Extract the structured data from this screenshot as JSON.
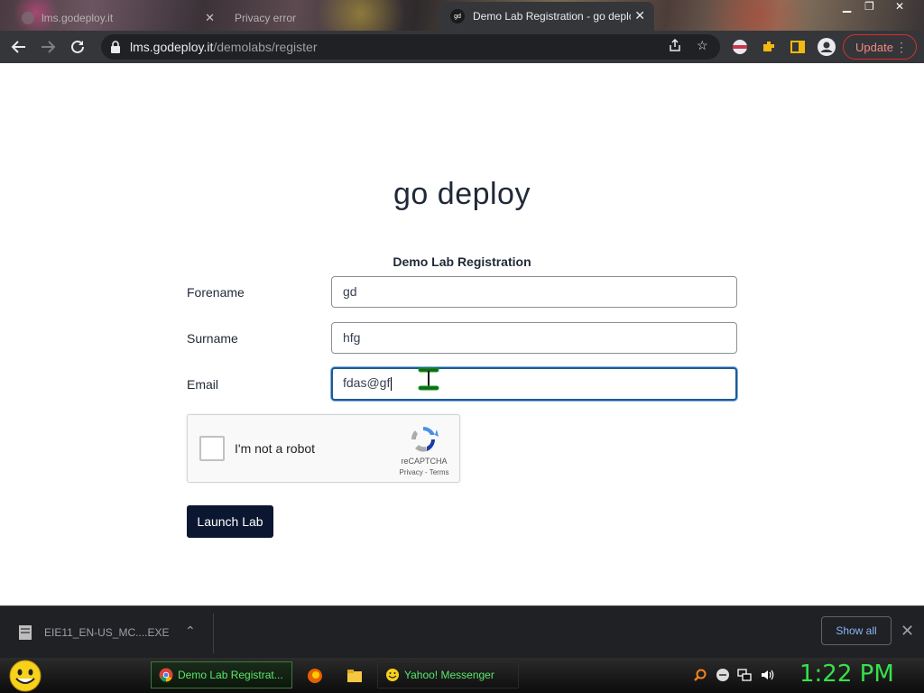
{
  "browser": {
    "tabs": [
      {
        "title": "lms.godeploy.it",
        "active": false
      },
      {
        "title": "Privacy error",
        "active": false
      },
      {
        "title": "Demo Lab Registration - go deploy",
        "active": true,
        "favicon_text": "gd"
      }
    ],
    "address": {
      "host": "lms.godeploy.it",
      "path": "/demolabs/register"
    },
    "update_label": "Update"
  },
  "page": {
    "brand": "go deploy",
    "form_title": "Demo Lab Registration",
    "fields": {
      "forename": {
        "label": "Forename",
        "value": "gd"
      },
      "surname": {
        "label": "Surname",
        "value": "hfg"
      },
      "email": {
        "label": "Email",
        "value": "fdas@gf"
      }
    },
    "recaptcha": {
      "label": "I'm not a robot",
      "brand": "reCAPTCHA",
      "privacy": "Privacy",
      "sep": " - ",
      "terms": "Terms"
    },
    "submit_label": "Launch Lab"
  },
  "download_bar": {
    "file_name": "EIE11_EN-US_MC....EXE",
    "show_all_label": "Show all"
  },
  "taskbar": {
    "tasks": [
      {
        "label": "Demo Lab Registrat...",
        "active": true
      },
      {
        "label": "Yahoo! Messenger",
        "active": false
      }
    ],
    "clock": "1:22 PM"
  },
  "colors": {
    "accent": "#1d5b94",
    "launch_button": "#0b1630",
    "update_red": "#d93025",
    "clock_green": "#36e24a"
  },
  "icons": [
    "back-arrow-icon",
    "forward-arrow-icon",
    "reload-icon",
    "lock-icon",
    "share-icon",
    "star-icon",
    "extension-icon",
    "puzzle-icon",
    "sidepanel-icon",
    "profile-icon",
    "kebab-menu-icon",
    "recaptcha-logo-icon",
    "file-icon",
    "chevron-up-icon",
    "close-icon",
    "yahoo-smiley-icon",
    "chrome-icon",
    "firefox-icon",
    "folder-icon",
    "search-tray-icon",
    "network-tray-icon",
    "volume-icon"
  ]
}
